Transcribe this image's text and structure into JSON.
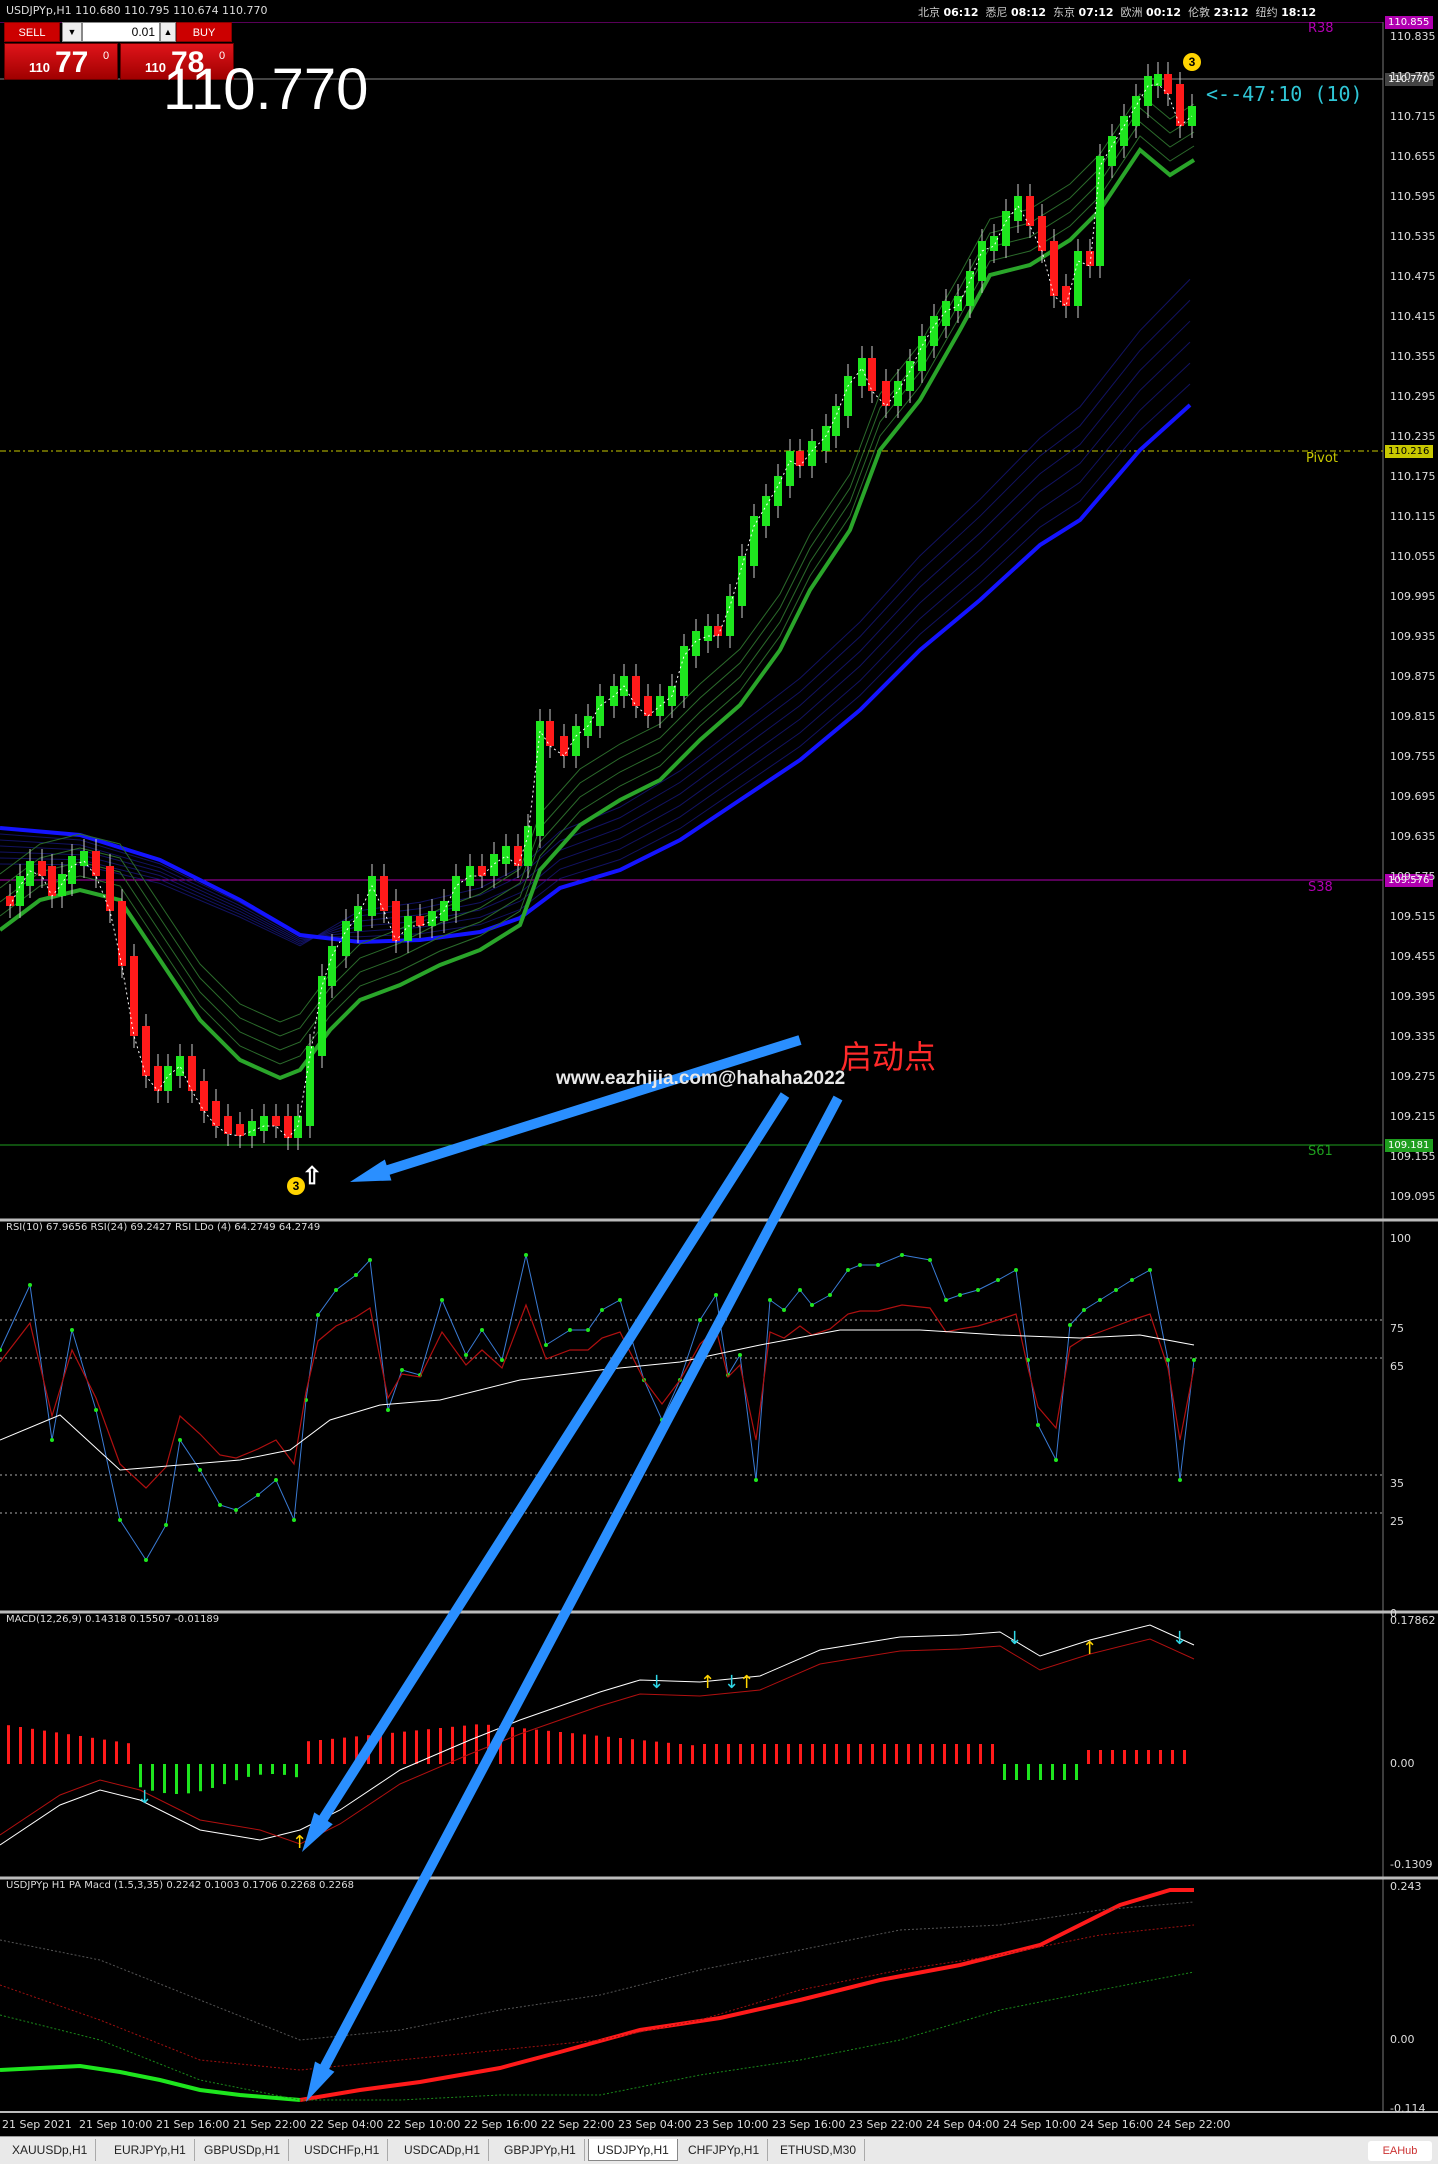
{
  "header": {
    "symbol_info": "USDJPYp,H1  110.680 110.795 110.674 110.770",
    "clocks": [
      {
        "city": "北京",
        "time": "06:12"
      },
      {
        "city": "悉尼",
        "time": "08:12"
      },
      {
        "city": "东京",
        "time": "07:12"
      },
      {
        "city": "欧洲",
        "time": "00:12"
      },
      {
        "city": "伦敦",
        "time": "23:12"
      },
      {
        "city": "纽约",
        "time": "18:12"
      }
    ]
  },
  "trade": {
    "sell_label": "SELL",
    "buy_label": "BUY",
    "lot": "0.01",
    "sell_prefix": "110",
    "sell_big": "77",
    "sell_sup": "0",
    "buy_prefix": "110",
    "buy_big": "78",
    "buy_sup": "0"
  },
  "big_price": "110.770",
  "countdown": "<--47:10 (10)",
  "watermark": "www.eazhijia.com@hahaha2022",
  "annotation": "启动点",
  "marker_number": "3",
  "price_axis": [
    "110.835",
    "110.775",
    "110.715",
    "110.655",
    "110.595",
    "110.535",
    "110.475",
    "110.415",
    "110.355",
    "110.295",
    "110.235",
    "110.175",
    "110.115",
    "110.055",
    "109.995",
    "109.935",
    "109.875",
    "109.815",
    "109.755",
    "109.695",
    "109.635",
    "109.575",
    "109.515",
    "109.455",
    "109.395",
    "109.335",
    "109.275",
    "109.215",
    "109.155",
    "109.095"
  ],
  "axis_tags": {
    "r38": "110.855",
    "current": "110.770",
    "pivot": "110.216",
    "s38": "109.576",
    "s61": "109.181"
  },
  "levels": {
    "r38": "R38",
    "pivot": "Pivot",
    "s38": "S38",
    "s61": "S61"
  },
  "rsi": {
    "title": "RSI(10) 67.9656  RSI(24) 69.2427  RSI LDo (4) 64.2749 64.2749",
    "axis": [
      "100",
      "75",
      "65",
      "35",
      "25",
      "0"
    ]
  },
  "macd": {
    "title": "MACD(12,26,9) 0.14318 0.15507 -0.01189",
    "axis": [
      "0.17862",
      "0.00",
      "-0.1309"
    ]
  },
  "pamacd": {
    "title": "USDJPYp H1 PA Macd (1.5,3,35) 0.2242 0.1003 0.1706 0.2268 0.2268",
    "axis": [
      "0.243",
      "0.00",
      "-0.114"
    ]
  },
  "time_axis": [
    "21 Sep 2021",
    "21 Sep 10:00",
    "21 Sep 16:00",
    "21 Sep 22:00",
    "22 Sep 04:00",
    "22 Sep 10:00",
    "22 Sep 16:00",
    "22 Sep 22:00",
    "23 Sep 04:00",
    "23 Sep 10:00",
    "23 Sep 16:00",
    "23 Sep 22:00",
    "24 Sep 04:00",
    "24 Sep 10:00",
    "24 Sep 16:00",
    "24 Sep 22:00"
  ],
  "tabs": [
    "XAUUSDp,H1",
    "EURJPYp,H1",
    "GBPUSDp,H1",
    "USDCHFp,H1",
    "USDCADp,H1",
    "GBPJPYp,H1",
    "USDJPYp,H1",
    "CHFJPYp,H1",
    "ETHUSD,M30"
  ],
  "active_tab": "USDJPYp,H1",
  "logo": "EAHub",
  "colors": {
    "bull": "#1ee61e",
    "bear": "#ff1a1a",
    "ma_blue": "#1414ff",
    "ma_green": "#2aa52a",
    "arrow": "#2a8fff",
    "r38": "#b000b0",
    "pivot": "#c8c800",
    "s61": "#1e9e1e"
  }
}
